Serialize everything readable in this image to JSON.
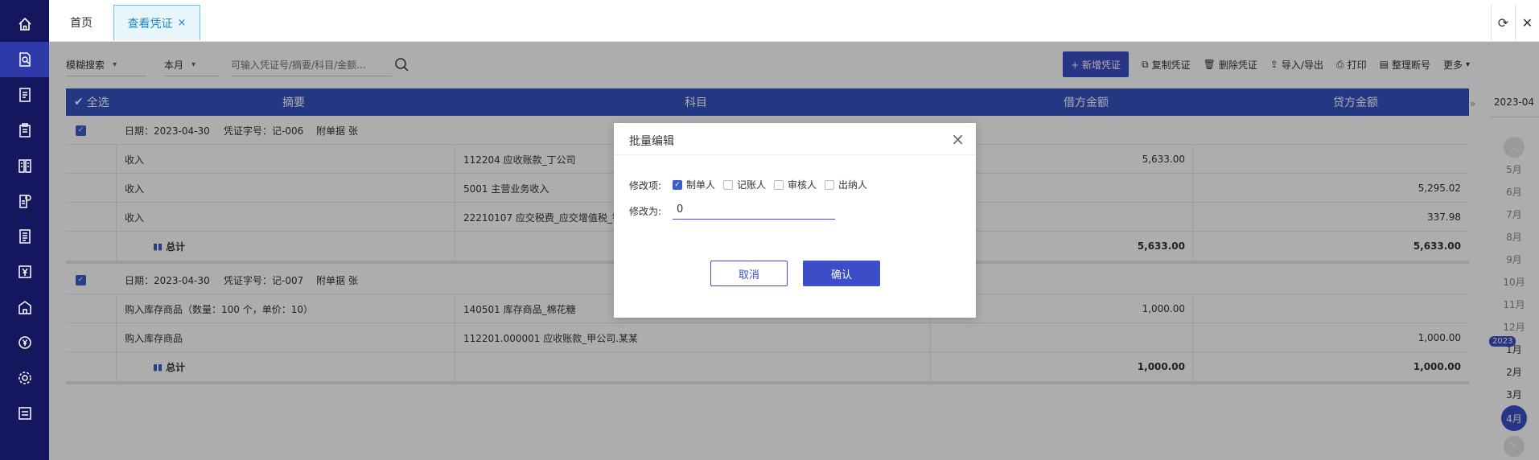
{
  "sidebar": {
    "items": [
      "home-icon",
      "voucher-search-icon",
      "ledger-icon",
      "clipboard-icon",
      "report-icon",
      "settings-doc-icon",
      "list-doc-icon",
      "yen-icon",
      "building-icon",
      "currency-icon",
      "gear-icon",
      "note-icon"
    ]
  },
  "tabs": {
    "home": "首页",
    "active": "查看凭证",
    "close": "×"
  },
  "toolbar": {
    "filter_mode": "模糊搜索",
    "period": "本月",
    "search_placeholder": "可输入凭证号/摘要/科目/金额...",
    "new_voucher": "+ 新增凭证",
    "copy": "复制凭证",
    "delete": "删除凭证",
    "import_export": "导入/导出",
    "print": "打印",
    "renumber": "整理断号",
    "more": "更多"
  },
  "table": {
    "headers": {
      "select_all": "全选",
      "summary": "摘要",
      "subject": "科目",
      "debit": "借方金额",
      "credit": "贷方金额"
    },
    "groups": [
      {
        "header": {
          "date": "日期：2023-04-30",
          "voucher_no": "凭证字号：记-006",
          "attachments": "附单据  张"
        },
        "rows": [
          {
            "summary": "收入",
            "subject": "112204  应收账款_丁公司",
            "debit": "5,633.00",
            "credit": ""
          },
          {
            "summary": "收入",
            "subject": "5001  主营业务收入",
            "debit": "",
            "credit": "5,295.02"
          },
          {
            "summary": "收入",
            "subject": "22210107  应交税费_应交增值税_销",
            "debit": "",
            "credit": "337.98"
          }
        ],
        "total_label": "总计",
        "total_debit": "5,633.00",
        "total_credit": "5,633.00"
      },
      {
        "header": {
          "date": "日期：2023-04-30",
          "voucher_no": "凭证字号：记-007",
          "attachments": "附单据  张"
        },
        "rows": [
          {
            "summary": "购入库存商品（数量：100 个，单价：10）",
            "subject": "140501  库存商品_棉花糖",
            "debit": "1,000.00",
            "credit": ""
          },
          {
            "summary": "购入库存商品",
            "subject": "112201.000001  应收账款_甲公司.某某",
            "debit": "",
            "credit": "1,000.00"
          }
        ],
        "total_label": "总计",
        "total_debit": "1,000.00",
        "total_credit": "1,000.00"
      }
    ]
  },
  "date_rail": {
    "current": "2023-04",
    "months_prev": [
      "5月",
      "6月",
      "7月",
      "8月",
      "9月",
      "10月",
      "11月",
      "12月"
    ],
    "year_badge": "2023",
    "months_next": [
      "1月",
      "2月",
      "3月"
    ],
    "selected": "4月"
  },
  "modal": {
    "title": "批量编辑",
    "close": "×",
    "field_label": "修改项:",
    "options": [
      {
        "label": "制单人",
        "checked": true
      },
      {
        "label": "记账人",
        "checked": false
      },
      {
        "label": "审核人",
        "checked": false
      },
      {
        "label": "出纳人",
        "checked": false
      }
    ],
    "value_label": "修改为:",
    "value": "0",
    "cancel": "取消",
    "confirm": "确认"
  },
  "colors": {
    "sidebar_bg": "#14165e",
    "accent": "#3b4ec7",
    "table_header": "#3552c1",
    "tab_active": "#1a88c4"
  }
}
